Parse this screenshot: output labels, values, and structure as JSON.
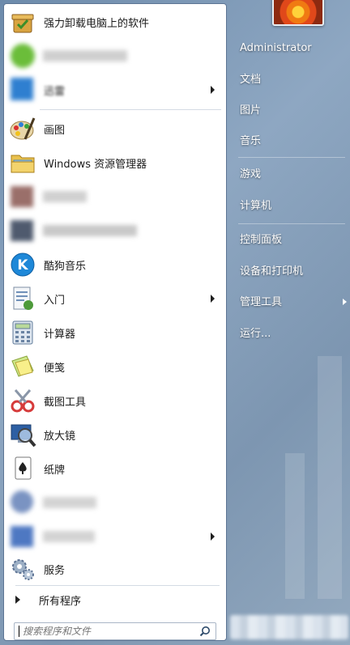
{
  "programs": [
    {
      "label": "强力卸载电脑上的软件",
      "icon": "uninstaller-icon",
      "blurred": false
    },
    {
      "label": "",
      "icon": "blurred-app-icon",
      "blurred": true
    },
    {
      "label": "迅雷",
      "icon": "blurred-app-icon",
      "blurred": true,
      "submenu": true
    },
    {
      "label": "画图",
      "icon": "paint-icon",
      "blurred": false
    },
    {
      "label": "Windows 资源管理器",
      "icon": "explorer-folder-icon",
      "blurred": false
    },
    {
      "label": "",
      "icon": "blurred-app-icon",
      "blurred": true
    },
    {
      "label": "",
      "icon": "blurred-app-icon",
      "blurred": true
    },
    {
      "label": "酷狗音乐",
      "icon": "kugou-icon",
      "blurred": false
    },
    {
      "label": "入门",
      "icon": "getting-started-icon",
      "blurred": false,
      "submenu": true
    },
    {
      "label": "计算器",
      "icon": "calculator-icon",
      "blurred": false
    },
    {
      "label": "便笺",
      "icon": "sticky-notes-icon",
      "blurred": false
    },
    {
      "label": "截图工具",
      "icon": "snipping-tool-icon",
      "blurred": false
    },
    {
      "label": "放大镜",
      "icon": "magnifier-icon",
      "blurred": false
    },
    {
      "label": "纸牌",
      "icon": "solitaire-icon",
      "blurred": false
    },
    {
      "label": "",
      "icon": "blurred-app-icon",
      "blurred": true
    },
    {
      "label": "",
      "icon": "blurred-app-icon",
      "blurred": true,
      "submenu": true
    },
    {
      "label": "服务",
      "icon": "services-gear-icon",
      "blurred": false
    }
  ],
  "all_programs_label": "所有程序",
  "search": {
    "placeholder": "搜索程序和文件"
  },
  "right_menu": {
    "user_name": "Administrator",
    "items": [
      {
        "label": "文档"
      },
      {
        "label": "图片"
      },
      {
        "label": "音乐"
      },
      {
        "label": "游戏"
      },
      {
        "label": "计算机"
      },
      {
        "label": "控制面板"
      },
      {
        "label": "设备和打印机"
      },
      {
        "label": "管理工具",
        "submenu": true
      },
      {
        "label": "运行..."
      }
    ]
  },
  "colors": {
    "accent_blue": "#1e88d8",
    "pane_border": "#5d7594"
  }
}
